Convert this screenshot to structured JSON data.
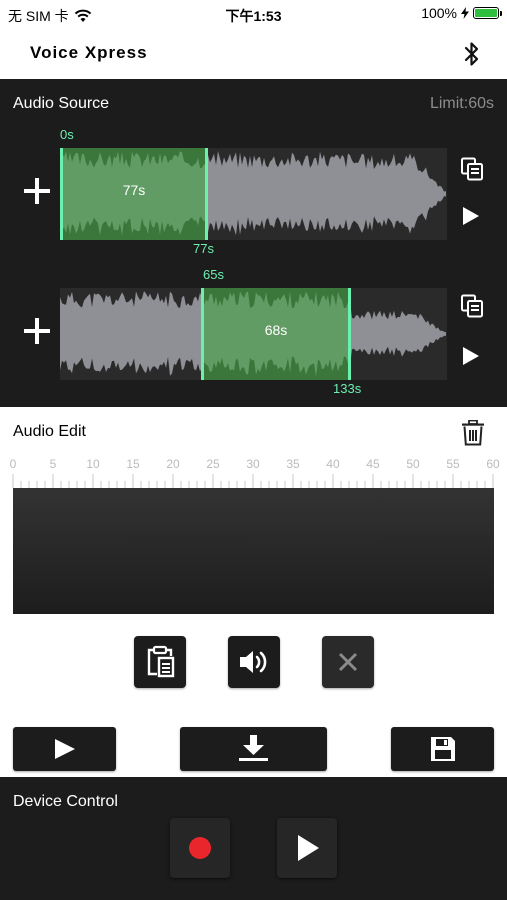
{
  "status_bar": {
    "carrier": "无 SIM 卡",
    "time": "下午1:53",
    "battery": "100%",
    "icons": [
      "wifi-icon",
      "charging-bolt-icon",
      "battery-icon"
    ]
  },
  "nav": {
    "title": "Voice Xpress",
    "bluetooth_icon": "bluetooth-icon"
  },
  "audio_source": {
    "heading": "Audio Source",
    "limit": "Limit:60s",
    "tracks": [
      {
        "start_label": "0s",
        "end_label": "77s",
        "selection_label": "77s",
        "selection_start_fraction": 0.0,
        "selection_end_fraction": 0.376
      },
      {
        "start_label": "65s",
        "end_label": "133s",
        "selection_label": "68s",
        "selection_start_fraction": 0.365,
        "selection_end_fraction": 0.745
      }
    ]
  },
  "audio_edit": {
    "heading": "Audio Edit",
    "ruler_ticks": [
      "0",
      "5",
      "10",
      "15",
      "20",
      "25",
      "30",
      "35",
      "40",
      "45",
      "50",
      "55",
      "60"
    ]
  },
  "device_control": {
    "heading": "Device Control"
  },
  "colors": {
    "panel": "#1c1c1c",
    "accent_green": "#6cf0b0",
    "selection_green": "#46a546",
    "record_red": "#e8262b",
    "muted_text": "#8c8c8c"
  }
}
